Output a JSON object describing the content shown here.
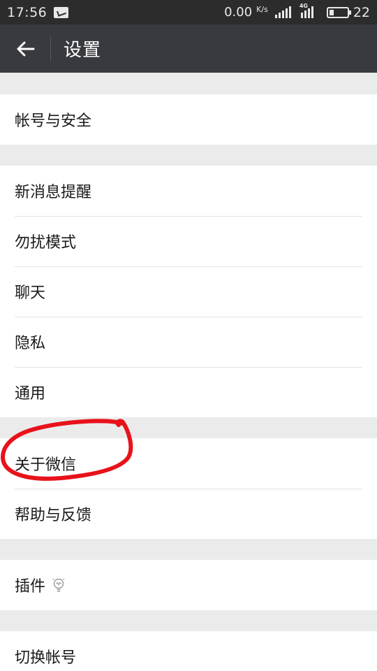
{
  "status_bar": {
    "time": "17:56",
    "net_speed": "0.00",
    "net_unit": "K/s",
    "network_type": "4G",
    "battery_level": 0.25,
    "battery_text": "22"
  },
  "header": {
    "title": "设置"
  },
  "groups": [
    {
      "items": [
        {
          "label": "帐号与安全"
        }
      ]
    },
    {
      "items": [
        {
          "label": "新消息提醒"
        },
        {
          "label": "勿扰模式"
        },
        {
          "label": "聊天"
        },
        {
          "label": "隐私"
        },
        {
          "label": "通用"
        }
      ]
    },
    {
      "items": [
        {
          "label": "关于微信"
        },
        {
          "label": "帮助与反馈"
        }
      ]
    },
    {
      "items": [
        {
          "label": "插件",
          "icon": "lightbulb-icon"
        }
      ]
    },
    {
      "items": [
        {
          "label": "切换帐号"
        }
      ]
    }
  ],
  "annotation": {
    "color": "#e8121b"
  }
}
